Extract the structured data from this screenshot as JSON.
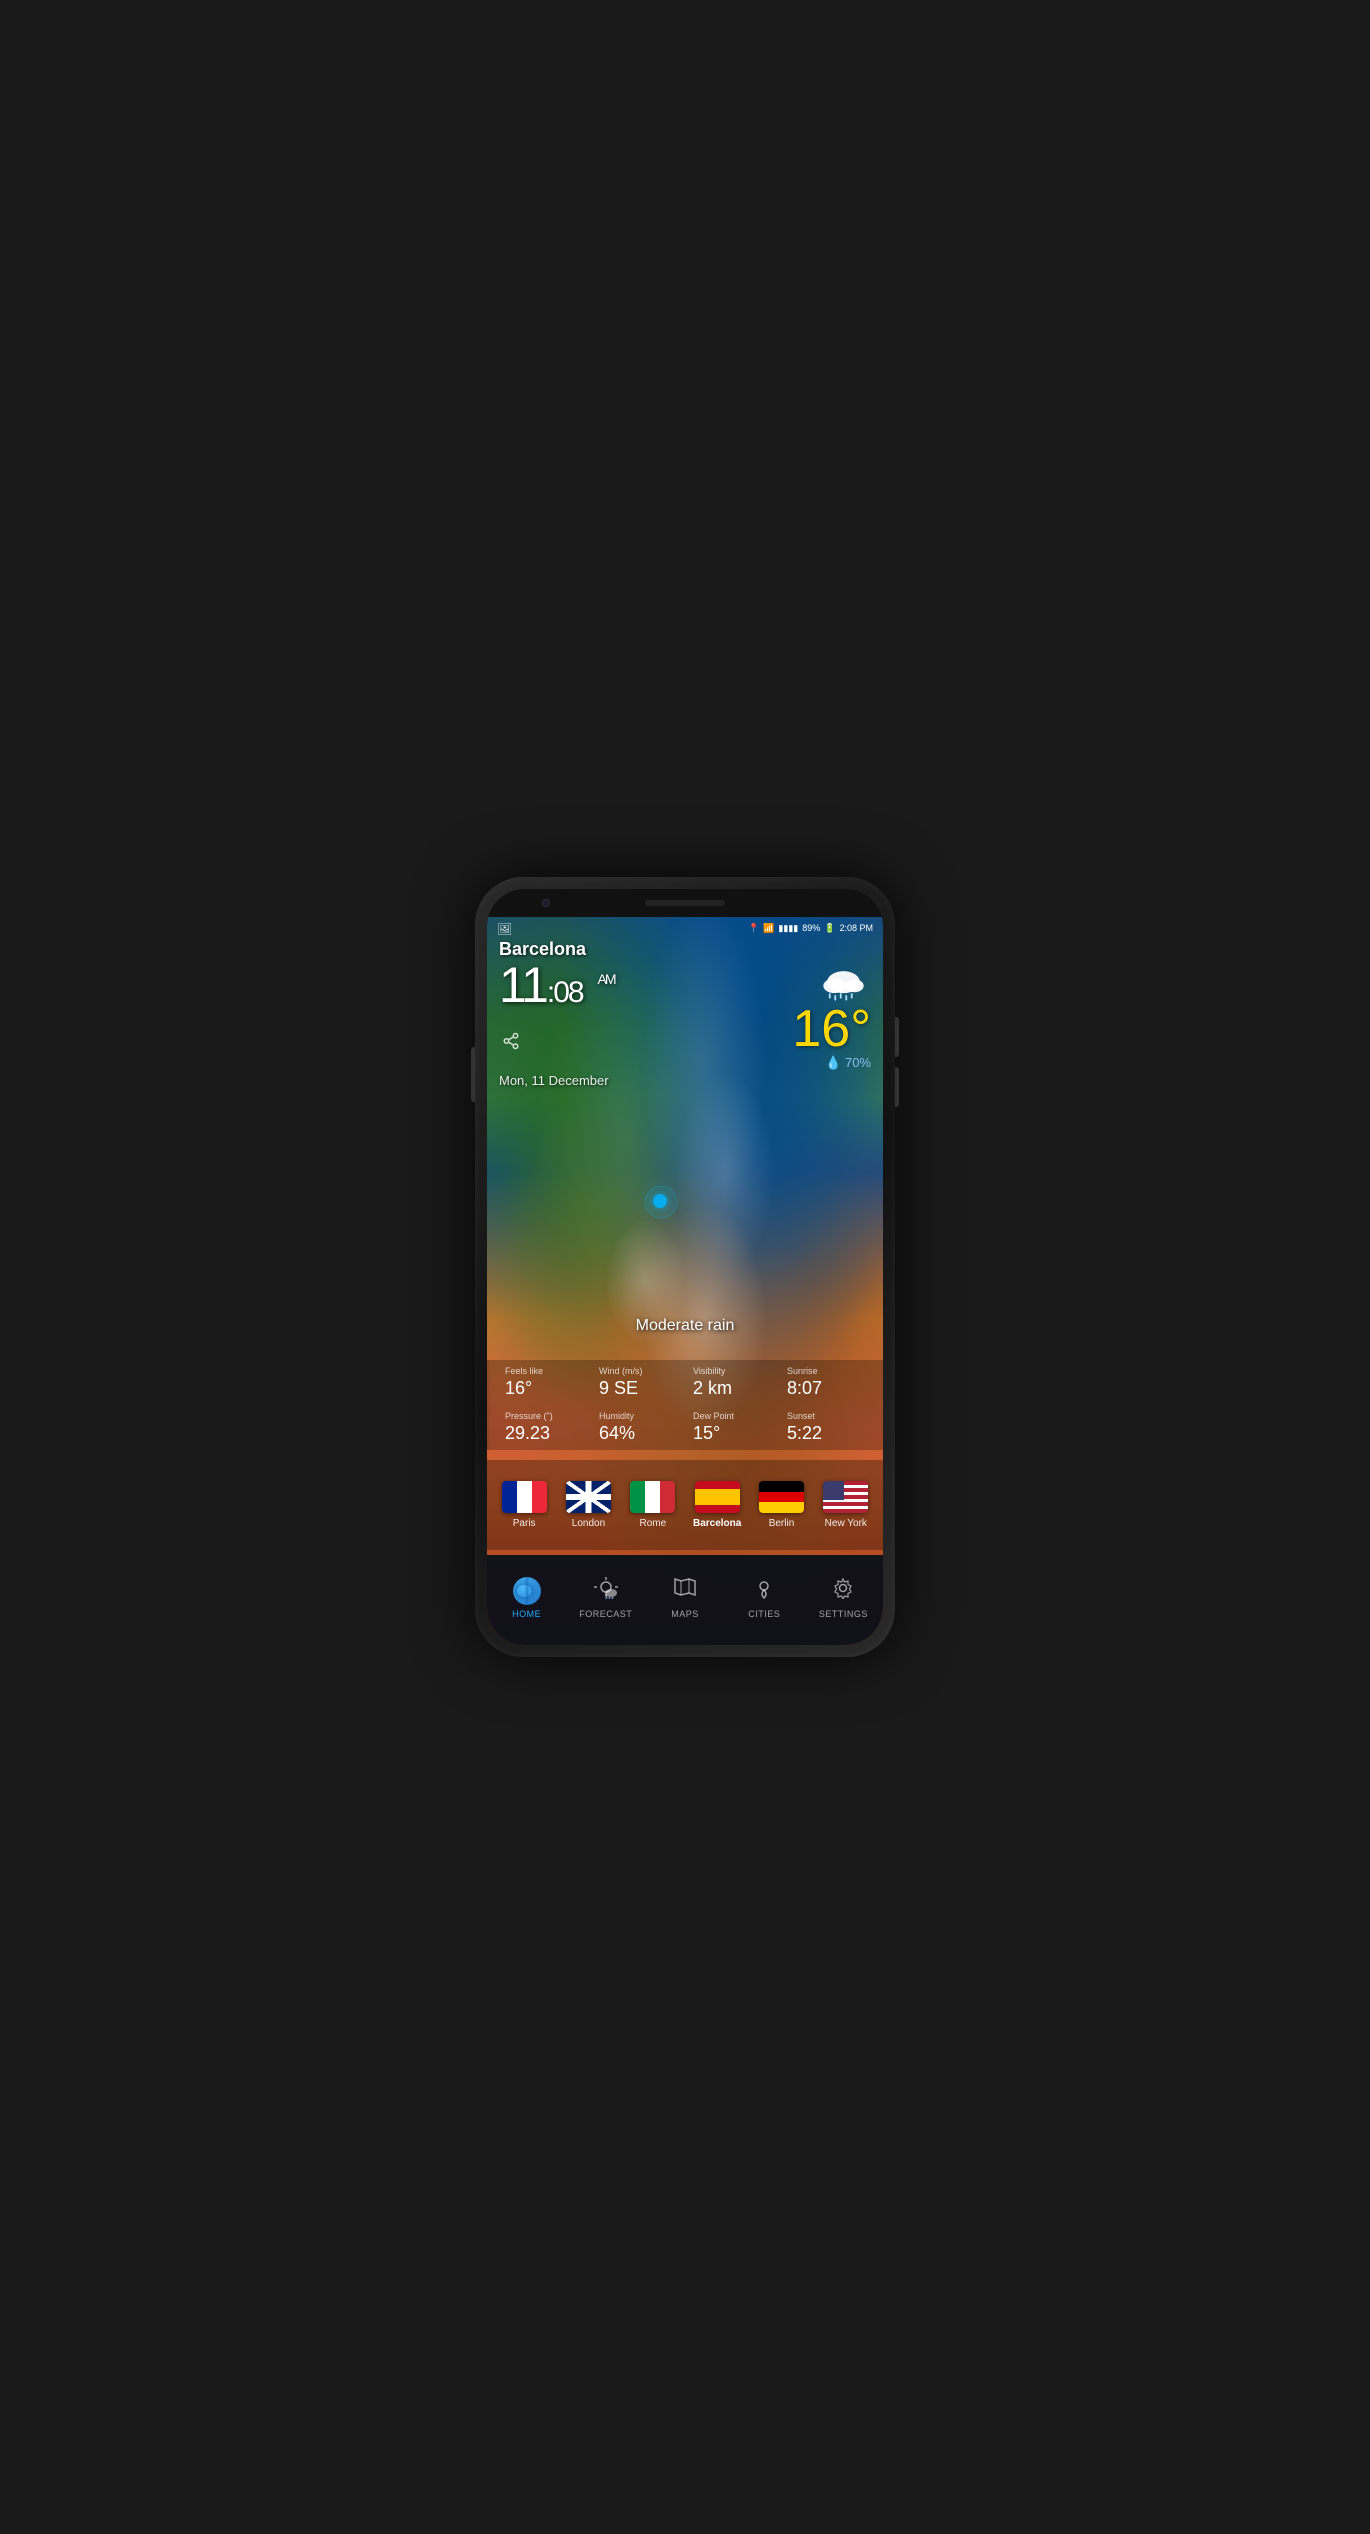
{
  "phone": {
    "status_bar": {
      "location_icon": "📍",
      "wifi_icon": "wifi",
      "signal_bars": "▮▮▮▮",
      "battery": "89%",
      "time": "2:08 PM"
    },
    "weather": {
      "city": "Barcelona",
      "time": "11",
      "time_minutes": ":08",
      "time_ampm": "AM",
      "date": "Mon, 11 December",
      "temperature": "16°",
      "condition": "Moderate rain",
      "rain_chance": "70%",
      "feels_like_label": "Feels like",
      "feels_like_value": "16°",
      "wind_label": "Wind (m/s)",
      "wind_value": "9 SE",
      "visibility_label": "Visibility",
      "visibility_value": "2 km",
      "sunrise_label": "Sunrise",
      "sunrise_value": "8:07",
      "pressure_label": "Pressure (\")",
      "pressure_value": "29.23",
      "humidity_label": "Humidity",
      "humidity_value": "64%",
      "dew_point_label": "Dew Point",
      "dew_point_value": "15°",
      "sunset_label": "Sunset",
      "sunset_value": "5:22"
    },
    "cities": [
      {
        "name": "Paris",
        "flag": "france",
        "active": false
      },
      {
        "name": "London",
        "flag": "uk",
        "active": false
      },
      {
        "name": "Rome",
        "flag": "italy",
        "active": false
      },
      {
        "name": "Barcelona",
        "flag": "spain",
        "active": true
      },
      {
        "name": "Berlin",
        "flag": "germany",
        "active": false
      },
      {
        "name": "New York",
        "flag": "usa",
        "active": false
      }
    ],
    "nav": [
      {
        "id": "home",
        "label": "HOME",
        "active": true
      },
      {
        "id": "forecast",
        "label": "FORECAST",
        "active": false
      },
      {
        "id": "maps",
        "label": "MAPS",
        "active": false
      },
      {
        "id": "cities",
        "label": "CITIES",
        "active": false
      },
      {
        "id": "settings",
        "label": "SETTINGS",
        "active": false
      }
    ]
  }
}
